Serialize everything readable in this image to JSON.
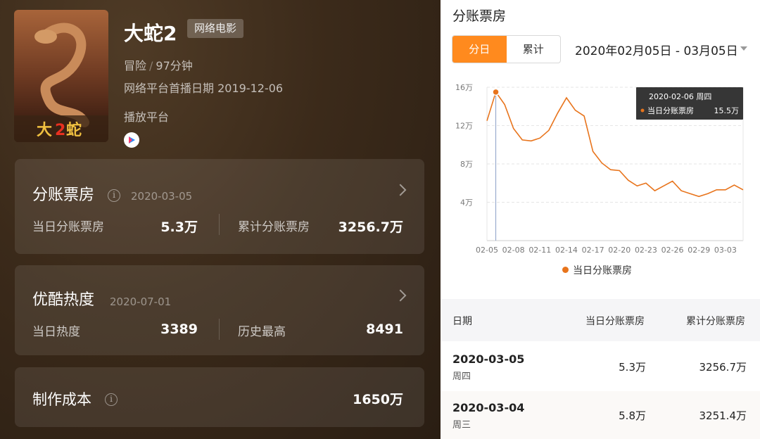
{
  "movie": {
    "title": "大蛇2",
    "tag": "网络电影",
    "genre": "冒险",
    "duration": "97分钟",
    "premiere": "网络平台首播日期 2019-12-06",
    "platform_label": "播放平台",
    "platform_icon": "youku-play-icon"
  },
  "box_office": {
    "title": "分账票房",
    "date": "2020-03-05",
    "daily_label": "当日分账票房",
    "daily_value": "5.3万",
    "total_label": "累计分账票房",
    "total_value": "3256.7万"
  },
  "heat": {
    "title": "优酷热度",
    "date": "2020-07-01",
    "daily_label": "当日热度",
    "daily_value": "3389",
    "max_label": "历史最高",
    "max_value": "8491"
  },
  "cost": {
    "title": "制作成本",
    "value": "1650万"
  },
  "right": {
    "title": "分账票房",
    "tab_daily": "分日",
    "tab_cumulative": "累计",
    "date_range": "2020年02月05日 - 03月05日",
    "tooltip_date": "2020-02-06 周四",
    "tooltip_label": "当日分账票房",
    "tooltip_value": "15.5万",
    "legend": "当日分账票房"
  },
  "chart_data": {
    "type": "line",
    "x": [
      "02-05",
      "02-06",
      "02-07",
      "02-08",
      "02-09",
      "02-10",
      "02-11",
      "02-12",
      "02-13",
      "02-14",
      "02-15",
      "02-16",
      "02-17",
      "02-18",
      "02-19",
      "02-20",
      "02-21",
      "02-22",
      "02-23",
      "02-24",
      "02-25",
      "02-26",
      "02-27",
      "02-28",
      "02-29",
      "03-01",
      "03-02",
      "03-03",
      "03-04",
      "03-05"
    ],
    "x_ticks": [
      "02-05",
      "02-08",
      "02-11",
      "02-14",
      "02-17",
      "02-20",
      "02-23",
      "02-26",
      "02-29",
      "03-03"
    ],
    "series": [
      {
        "name": "当日分账票房",
        "color": "#e8741c",
        "values": [
          12.5,
          15.5,
          14.2,
          11.7,
          10.5,
          10.4,
          10.7,
          11.5,
          13.3,
          14.9,
          13.6,
          13.0,
          9.3,
          8.1,
          7.4,
          7.3,
          6.3,
          5.7,
          6.0,
          5.2,
          5.7,
          6.2,
          5.2,
          4.9,
          4.6,
          4.9,
          5.3,
          5.3,
          5.8,
          5.3
        ]
      }
    ],
    "y_ticks": [
      "4万",
      "8万",
      "12万",
      "16万"
    ],
    "y_tick_values": [
      4,
      8,
      12,
      16
    ],
    "ylim": [
      0,
      16
    ],
    "highlight_index": 1,
    "grid": true
  },
  "table": {
    "headers": [
      "日期",
      "当日分账票房",
      "累计分账票房"
    ],
    "rows": [
      {
        "date": "2020-03-05",
        "weekday": "周四",
        "daily": "5.3万",
        "total": "3256.7万"
      },
      {
        "date": "2020-03-04",
        "weekday": "周三",
        "daily": "5.8万",
        "total": "3251.4万"
      }
    ]
  }
}
